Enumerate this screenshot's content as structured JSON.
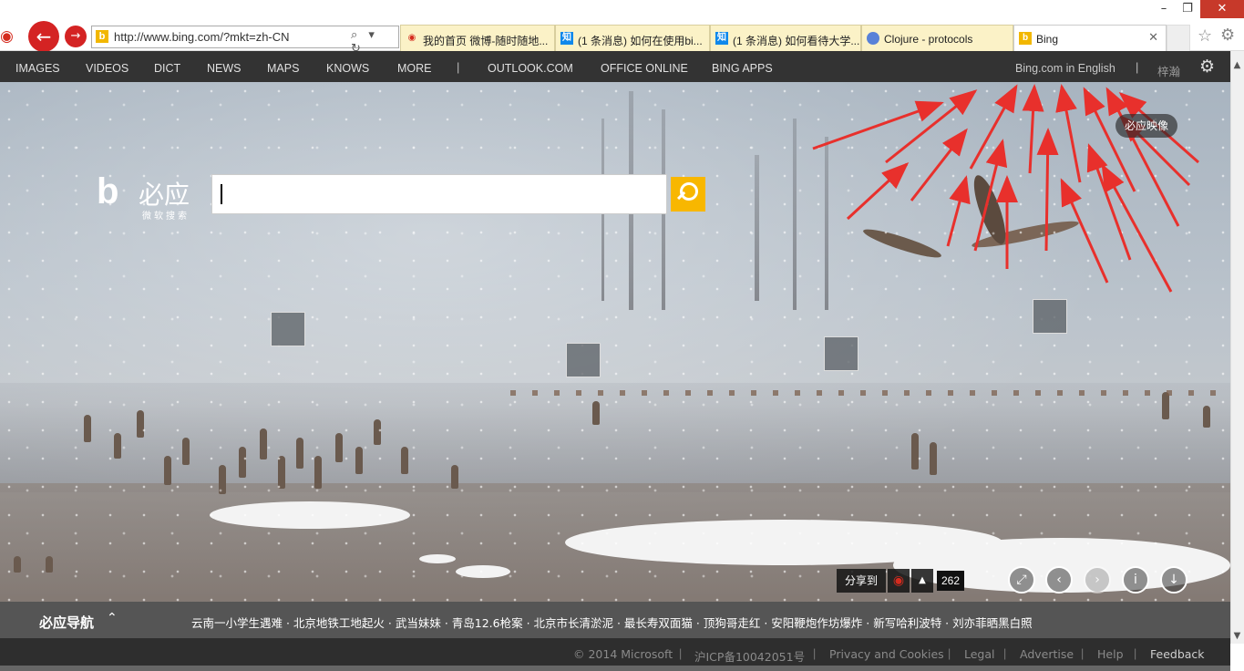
{
  "browser": {
    "address": "http://www.bing.com/?mkt=zh-CN",
    "address_controls": "⌕ ▾ ↻",
    "window_controls": {
      "minimize": "–",
      "maximize": "❐",
      "close": "✕"
    },
    "tabs": [
      {
        "label": "我的首页 微博-随时随地...",
        "icon": "weibo-icon"
      },
      {
        "label": "(1 条消息) 如何在使用bi...",
        "icon": "zhihu-icon"
      },
      {
        "label": "(1 条消息) 如何看待大学...",
        "icon": "zhihu-icon"
      },
      {
        "label": "Clojure - protocols",
        "icon": "clojure-icon"
      },
      {
        "label": "Bing",
        "icon": "bing-icon",
        "close": "✕"
      }
    ]
  },
  "header": {
    "nav": [
      "IMAGES",
      "VIDEOS",
      "DICT",
      "NEWS",
      "MAPS",
      "KNOWS",
      "MORE",
      "OUTLOOK.COM",
      "OFFICE ONLINE",
      "BING APPS"
    ],
    "separator": "|",
    "english_link": "Bing.com in English",
    "user": "梓瀚"
  },
  "logo": {
    "mark": "b",
    "name": "必应",
    "sub": "微软搜索"
  },
  "search": {
    "value": "",
    "placeholder": ""
  },
  "image_badge": "必应映像",
  "share": {
    "label": "分享到",
    "count": "262"
  },
  "image_controls": [
    "expand-icon",
    "previous-icon",
    "next-icon",
    "info-icon",
    "download-icon"
  ],
  "news": {
    "title": "必应导航",
    "toggle": "⌃",
    "items": "云南一小学生遇难 · 北京地铁工地起火 · 武当妹妹 · 青岛12.6枪案 · 北京市长清淤泥 · 最长寿双面猫 · 顶狗哥走红 · 安阳鞭炮作坊爆炸 · 新写哈利波特 · 刘亦菲晒黑白照"
  },
  "footer": {
    "copyright": "© 2014 Microsoft",
    "icp": "沪ICP备10042051号",
    "privacy": "Privacy and Cookies",
    "legal": "Legal",
    "advertise": "Advertise",
    "help": "Help",
    "feedback": "Feedback",
    "separator": "|"
  },
  "colors": {
    "bing_yellow": "#f8b700",
    "header_bg": "#333333",
    "arrow_red": "#e8302c",
    "back_button": "#d42323"
  }
}
